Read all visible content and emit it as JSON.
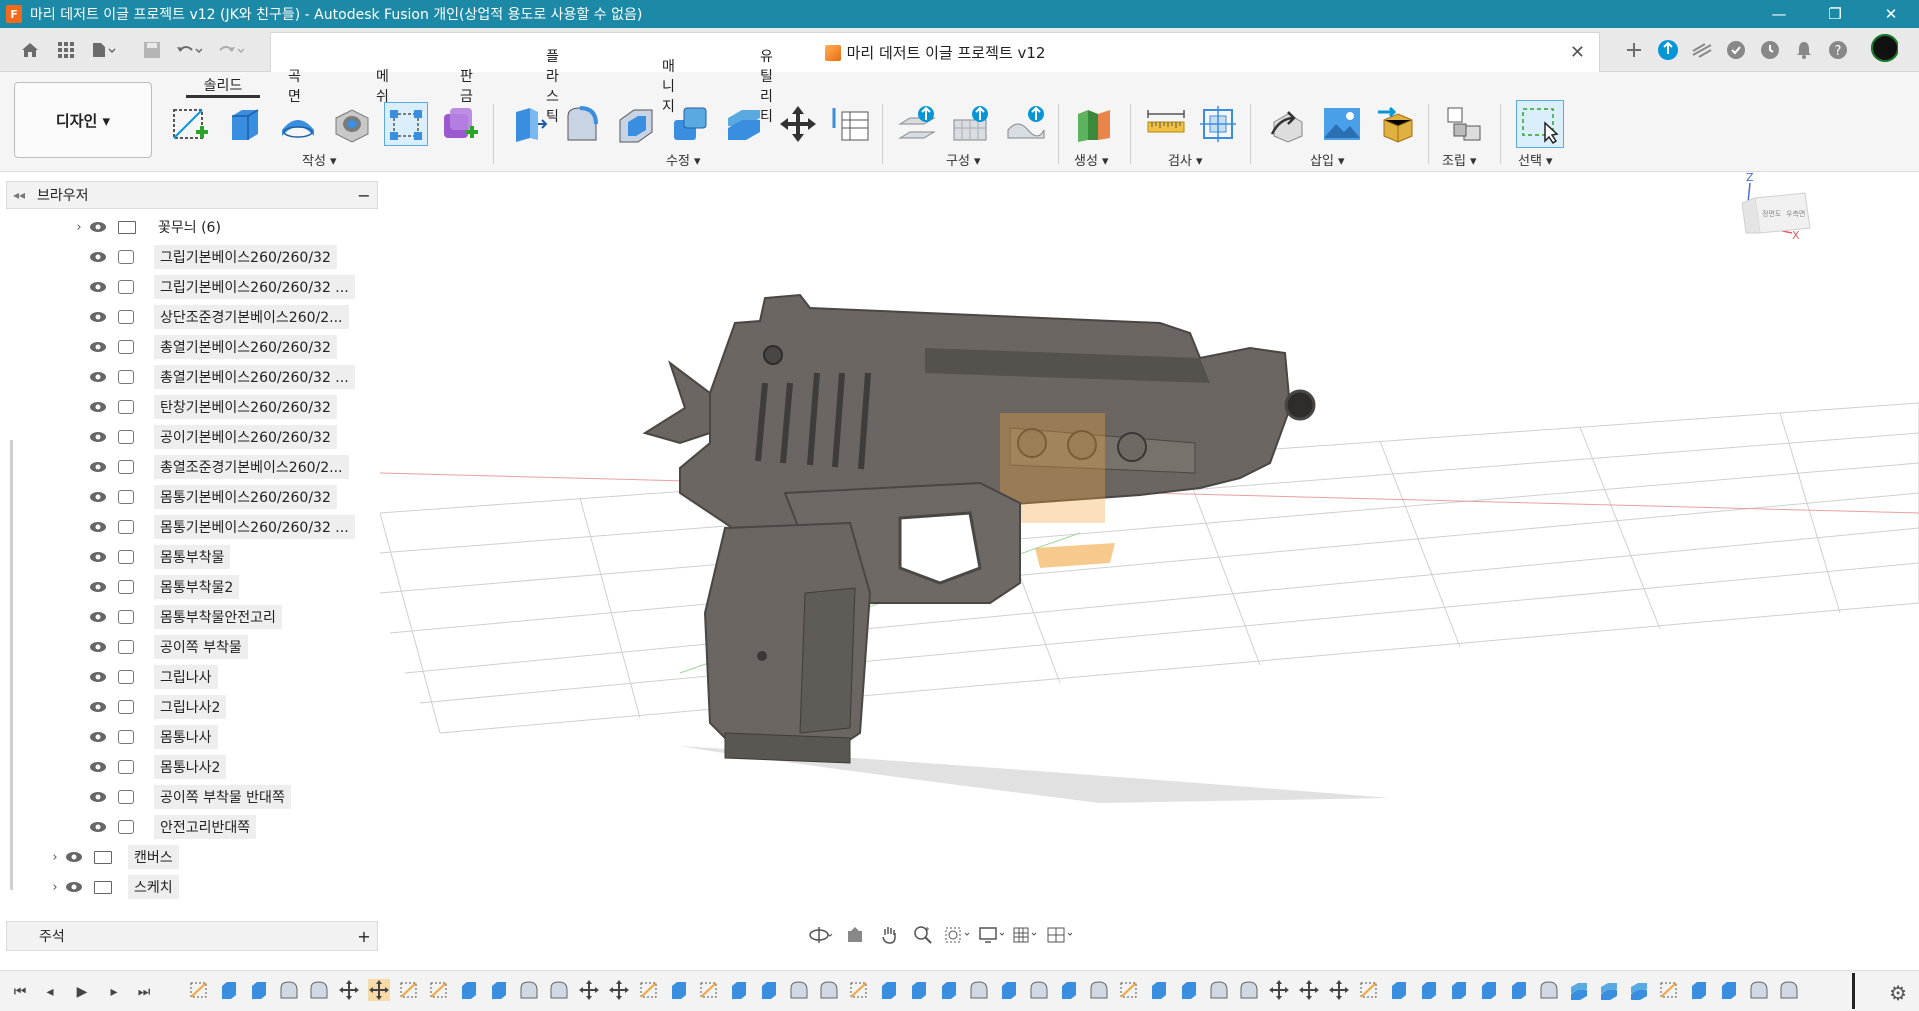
{
  "window": {
    "title": "마리 데저트 이글 프로젝트 v12 (JK와 친구들) - Autodesk Fusion 개인(상업적 용도로 사용할 수 없음)",
    "app_icon": "F",
    "minimize": "—",
    "maximize": "❐",
    "close": "✕"
  },
  "doc_tab": {
    "title": "마리 데저트 이글 프로젝트 v12",
    "close": "✕"
  },
  "workspace": {
    "label": "디자인 ▾"
  },
  "tabs": [
    "솔리드",
    "곡면",
    "메쉬",
    "판금",
    "플라스틱",
    "매니지",
    "유틸리티"
  ],
  "groups": {
    "create": "작성 ▾",
    "modify": "수정 ▾",
    "construct": "구성 ▾",
    "generate": "생성 ▾",
    "inspect": "검사 ▾",
    "insert": "삽입 ▾",
    "assemble": "조립 ▾",
    "select": "선택 ▾"
  },
  "browser": {
    "title": "브라우저",
    "items": [
      {
        "label": "꽃무늬 (6)",
        "type": "folder",
        "expand": "›"
      },
      {
        "label": "그립기본베이스260/260/32",
        "type": "body"
      },
      {
        "label": "그립기본베이스260/260/32 ...",
        "type": "body"
      },
      {
        "label": "상단조준경기본베이스260/2...",
        "type": "body"
      },
      {
        "label": "총열기본베이스260/260/32",
        "type": "body"
      },
      {
        "label": "총열기본베이스260/260/32 ...",
        "type": "body"
      },
      {
        "label": "탄창기본베이스260/260/32",
        "type": "body"
      },
      {
        "label": "공이기본베이스260/260/32",
        "type": "body"
      },
      {
        "label": "총열조준경기본베이스260/2...",
        "type": "body"
      },
      {
        "label": "몸통기본베이스260/260/32",
        "type": "body"
      },
      {
        "label": "몸통기본베이스260/260/32 ...",
        "type": "body"
      },
      {
        "label": "몸통부착물",
        "type": "body"
      },
      {
        "label": "몸통부착물2",
        "type": "body"
      },
      {
        "label": "몸통부착물안전고리",
        "type": "body"
      },
      {
        "label": "공이쪽 부착물",
        "type": "body"
      },
      {
        "label": "그립나사",
        "type": "body"
      },
      {
        "label": "그립나사2",
        "type": "body"
      },
      {
        "label": "몸통나사",
        "type": "body"
      },
      {
        "label": "몸통나사2",
        "type": "body"
      },
      {
        "label": "공이쪽 부착물 반대쪽",
        "type": "body"
      },
      {
        "label": "안전고리반대쪽",
        "type": "body"
      }
    ],
    "folders": [
      {
        "label": "캔버스",
        "expand": "›"
      },
      {
        "label": "스케치",
        "expand": "›"
      }
    ]
  },
  "notes": {
    "title": "주석",
    "add": "+"
  },
  "viewcube": {
    "z": "Z",
    "x": "X",
    "front": "정면도",
    "right": "우측면"
  },
  "colors": {
    "titlebar": "#1c8aa6",
    "accent": "#0696d7",
    "model": "#6b6661",
    "highlight": "#f0a640"
  }
}
